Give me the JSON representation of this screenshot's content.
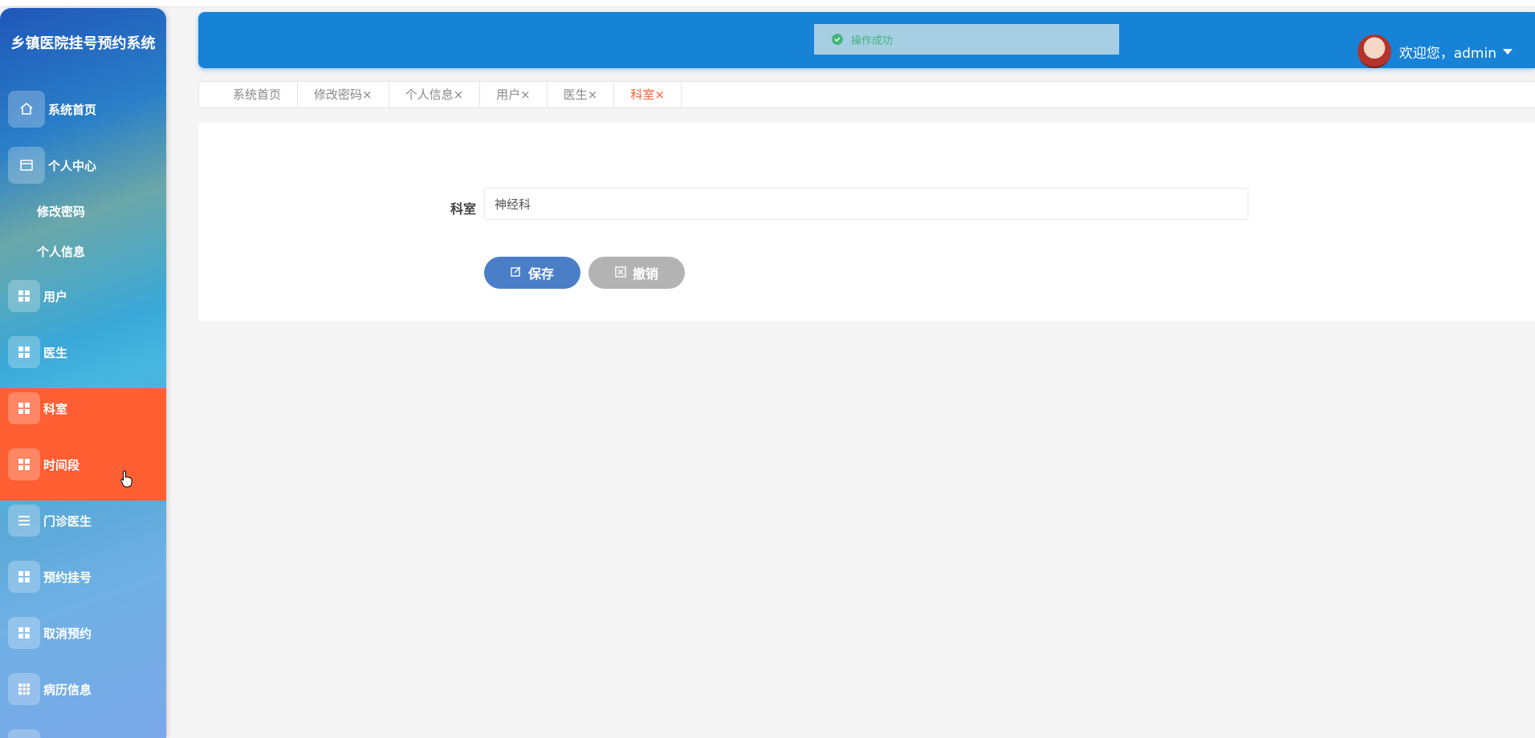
{
  "app_title": "乡镇医院挂号预约系统",
  "sidebar": {
    "items": [
      {
        "label": "系统首页",
        "icon": "home-icon"
      },
      {
        "label": "个人中心",
        "icon": "card-icon"
      },
      {
        "label": "用户",
        "icon": "grid-icon"
      },
      {
        "label": "医生",
        "icon": "grid-icon"
      },
      {
        "label": "科室",
        "icon": "grid-icon"
      },
      {
        "label": "时间段",
        "icon": "grid-icon"
      },
      {
        "label": "门诊医生",
        "icon": "list-icon"
      },
      {
        "label": "预约挂号",
        "icon": "grid-icon"
      },
      {
        "label": "取消预约",
        "icon": "grid-icon"
      },
      {
        "label": "病历信息",
        "icon": "table-icon"
      }
    ],
    "submenu": [
      "修改密码",
      "个人信息"
    ],
    "active_color": "#ff5f32"
  },
  "header": {
    "toast": "操作成功",
    "welcome": "欢迎您，admin"
  },
  "tabs": [
    "系统首页",
    "修改密码×",
    "个人信息×",
    "用户×",
    "医生×",
    "科室×"
  ],
  "active_tab": "科室×",
  "form": {
    "label": "科室",
    "value": "神经科",
    "save_label": "保存",
    "cancel_label": "撤销"
  },
  "colors": {
    "header": "#1783d7",
    "accent": "#ff5f32",
    "save": "#4a7fc8",
    "cancel": "#b3b3b3",
    "toast_text": "#43b47a"
  }
}
